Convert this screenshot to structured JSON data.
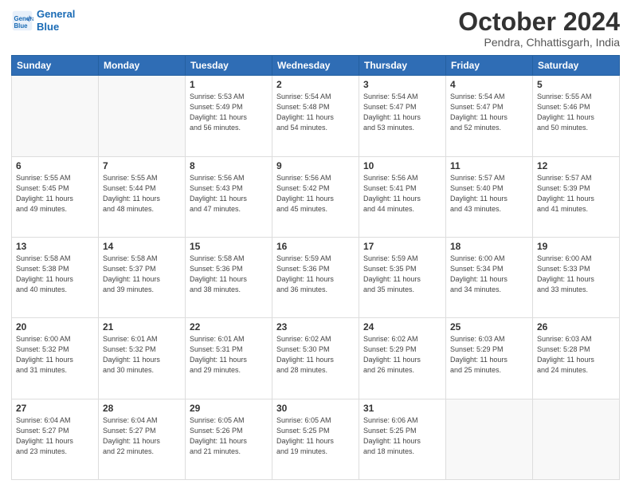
{
  "header": {
    "logo_line1": "General",
    "logo_line2": "Blue",
    "month": "October 2024",
    "location": "Pendra, Chhattisgarh, India"
  },
  "weekdays": [
    "Sunday",
    "Monday",
    "Tuesday",
    "Wednesday",
    "Thursday",
    "Friday",
    "Saturday"
  ],
  "weeks": [
    [
      {
        "day": "",
        "info": ""
      },
      {
        "day": "",
        "info": ""
      },
      {
        "day": "1",
        "info": "Sunrise: 5:53 AM\nSunset: 5:49 PM\nDaylight: 11 hours\nand 56 minutes."
      },
      {
        "day": "2",
        "info": "Sunrise: 5:54 AM\nSunset: 5:48 PM\nDaylight: 11 hours\nand 54 minutes."
      },
      {
        "day": "3",
        "info": "Sunrise: 5:54 AM\nSunset: 5:47 PM\nDaylight: 11 hours\nand 53 minutes."
      },
      {
        "day": "4",
        "info": "Sunrise: 5:54 AM\nSunset: 5:47 PM\nDaylight: 11 hours\nand 52 minutes."
      },
      {
        "day": "5",
        "info": "Sunrise: 5:55 AM\nSunset: 5:46 PM\nDaylight: 11 hours\nand 50 minutes."
      }
    ],
    [
      {
        "day": "6",
        "info": "Sunrise: 5:55 AM\nSunset: 5:45 PM\nDaylight: 11 hours\nand 49 minutes."
      },
      {
        "day": "7",
        "info": "Sunrise: 5:55 AM\nSunset: 5:44 PM\nDaylight: 11 hours\nand 48 minutes."
      },
      {
        "day": "8",
        "info": "Sunrise: 5:56 AM\nSunset: 5:43 PM\nDaylight: 11 hours\nand 47 minutes."
      },
      {
        "day": "9",
        "info": "Sunrise: 5:56 AM\nSunset: 5:42 PM\nDaylight: 11 hours\nand 45 minutes."
      },
      {
        "day": "10",
        "info": "Sunrise: 5:56 AM\nSunset: 5:41 PM\nDaylight: 11 hours\nand 44 minutes."
      },
      {
        "day": "11",
        "info": "Sunrise: 5:57 AM\nSunset: 5:40 PM\nDaylight: 11 hours\nand 43 minutes."
      },
      {
        "day": "12",
        "info": "Sunrise: 5:57 AM\nSunset: 5:39 PM\nDaylight: 11 hours\nand 41 minutes."
      }
    ],
    [
      {
        "day": "13",
        "info": "Sunrise: 5:58 AM\nSunset: 5:38 PM\nDaylight: 11 hours\nand 40 minutes."
      },
      {
        "day": "14",
        "info": "Sunrise: 5:58 AM\nSunset: 5:37 PM\nDaylight: 11 hours\nand 39 minutes."
      },
      {
        "day": "15",
        "info": "Sunrise: 5:58 AM\nSunset: 5:36 PM\nDaylight: 11 hours\nand 38 minutes."
      },
      {
        "day": "16",
        "info": "Sunrise: 5:59 AM\nSunset: 5:36 PM\nDaylight: 11 hours\nand 36 minutes."
      },
      {
        "day": "17",
        "info": "Sunrise: 5:59 AM\nSunset: 5:35 PM\nDaylight: 11 hours\nand 35 minutes."
      },
      {
        "day": "18",
        "info": "Sunrise: 6:00 AM\nSunset: 5:34 PM\nDaylight: 11 hours\nand 34 minutes."
      },
      {
        "day": "19",
        "info": "Sunrise: 6:00 AM\nSunset: 5:33 PM\nDaylight: 11 hours\nand 33 minutes."
      }
    ],
    [
      {
        "day": "20",
        "info": "Sunrise: 6:00 AM\nSunset: 5:32 PM\nDaylight: 11 hours\nand 31 minutes."
      },
      {
        "day": "21",
        "info": "Sunrise: 6:01 AM\nSunset: 5:32 PM\nDaylight: 11 hours\nand 30 minutes."
      },
      {
        "day": "22",
        "info": "Sunrise: 6:01 AM\nSunset: 5:31 PM\nDaylight: 11 hours\nand 29 minutes."
      },
      {
        "day": "23",
        "info": "Sunrise: 6:02 AM\nSunset: 5:30 PM\nDaylight: 11 hours\nand 28 minutes."
      },
      {
        "day": "24",
        "info": "Sunrise: 6:02 AM\nSunset: 5:29 PM\nDaylight: 11 hours\nand 26 minutes."
      },
      {
        "day": "25",
        "info": "Sunrise: 6:03 AM\nSunset: 5:29 PM\nDaylight: 11 hours\nand 25 minutes."
      },
      {
        "day": "26",
        "info": "Sunrise: 6:03 AM\nSunset: 5:28 PM\nDaylight: 11 hours\nand 24 minutes."
      }
    ],
    [
      {
        "day": "27",
        "info": "Sunrise: 6:04 AM\nSunset: 5:27 PM\nDaylight: 11 hours\nand 23 minutes."
      },
      {
        "day": "28",
        "info": "Sunrise: 6:04 AM\nSunset: 5:27 PM\nDaylight: 11 hours\nand 22 minutes."
      },
      {
        "day": "29",
        "info": "Sunrise: 6:05 AM\nSunset: 5:26 PM\nDaylight: 11 hours\nand 21 minutes."
      },
      {
        "day": "30",
        "info": "Sunrise: 6:05 AM\nSunset: 5:25 PM\nDaylight: 11 hours\nand 19 minutes."
      },
      {
        "day": "31",
        "info": "Sunrise: 6:06 AM\nSunset: 5:25 PM\nDaylight: 11 hours\nand 18 minutes."
      },
      {
        "day": "",
        "info": ""
      },
      {
        "day": "",
        "info": ""
      }
    ]
  ]
}
